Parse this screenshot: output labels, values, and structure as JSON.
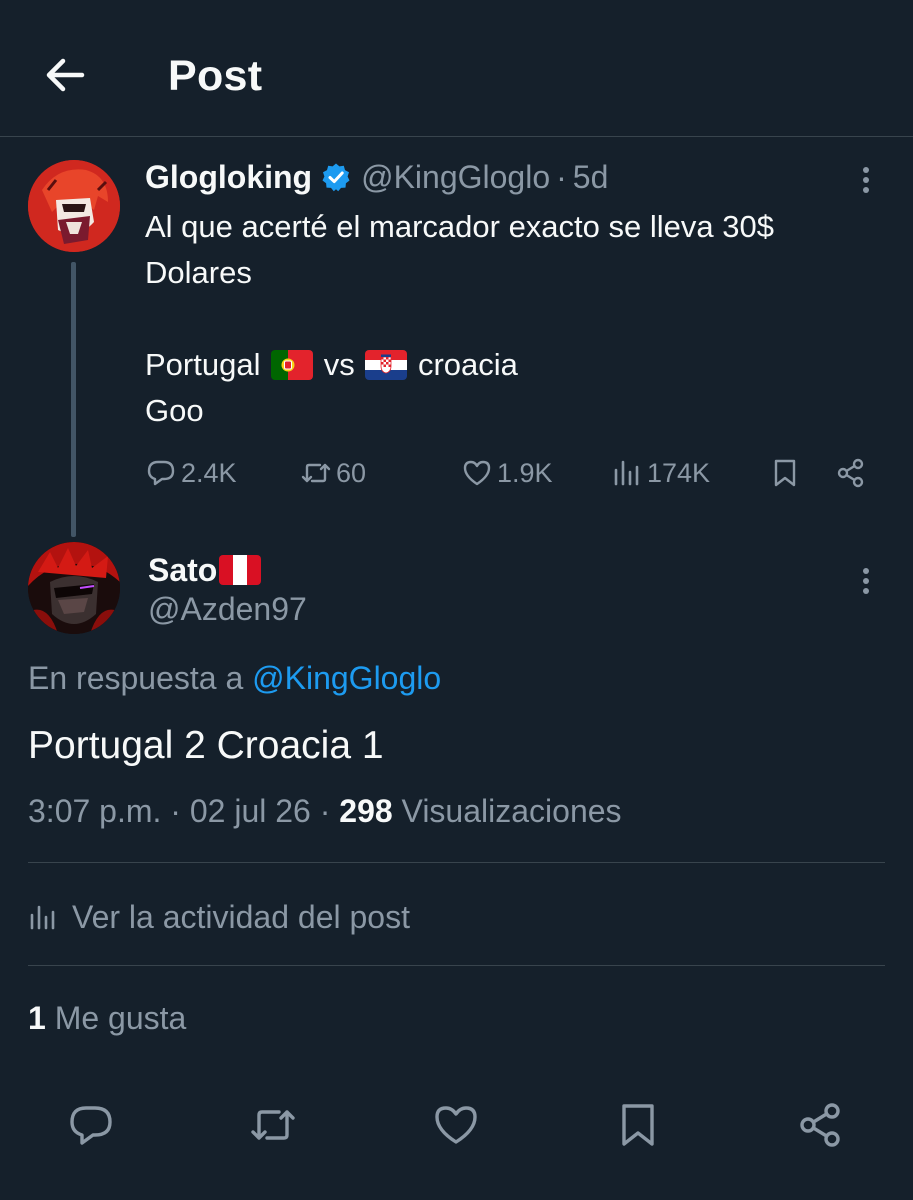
{
  "header": {
    "title": "Post"
  },
  "parent_tweet": {
    "author_name": "Glogloking",
    "handle": "@KingGloglo",
    "separator": "·",
    "time_ago": "5d",
    "text_line1": "Al que acerté el marcador exacto  se lleva 30$",
    "text_line2": "Dolares",
    "text_line4_a": "Portugal",
    "text_line4_b": "vs",
    "text_line4_c": "croacia",
    "text_line5": "Goo",
    "flags": [
      "portugal-flag",
      "croatia-flag"
    ],
    "stats": {
      "replies": "2.4K",
      "reposts": "60",
      "likes": "1.9K",
      "views": "174K"
    }
  },
  "reply": {
    "author_name": "Sato",
    "author_flag": "peru-flag",
    "handle": "@Azden97",
    "reply_prefix": "En respuesta a",
    "reply_mention": "@KingGloglo",
    "text": "Portugal 2 Croacia 1",
    "time": "3:07 p.m.",
    "date": "02 jul 26",
    "separator": "·",
    "views_count": "298",
    "views_label": "Visualizaciones",
    "activity_label": "Ver la actividad del post",
    "likes_count": "1",
    "likes_label": "Me gusta"
  },
  "colors": {
    "background": "#15202b",
    "text": "#f7f9f9",
    "muted": "#8b98a5",
    "accent": "#1d9bf0",
    "divider": "#38444d"
  }
}
